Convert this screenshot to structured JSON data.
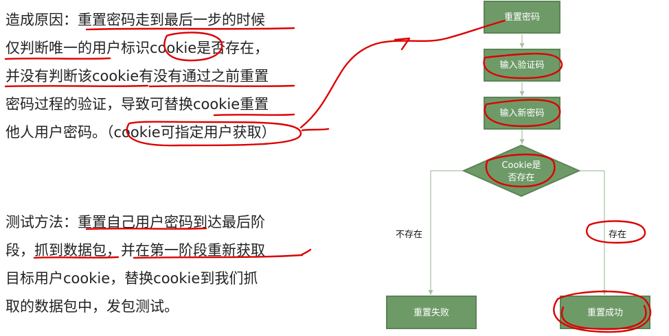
{
  "paragraph1": {
    "lines": [
      "造成原因：重置密码走到最后一步的时候",
      "仅判断唯一的用户标识cookie是否存在，",
      "并没有判断该cookie有没有通过之前重置",
      "密码过程的验证，导致可替换cookie重置",
      "他人用户密码。（cookie可指定用户获取）"
    ]
  },
  "paragraph2": {
    "lines": [
      "测试方法：重置自己用户密码到达最后阶",
      "段，抓到数据包，并在第一阶段重新获取",
      "目标用户cookie，替换cookie到我们抓",
      "取的数据包中，发包测试。"
    ]
  },
  "flowchart": {
    "step1": "重置密码",
    "step2": "输入验证码",
    "step3": "输入新密码",
    "decision_line1": "Cookie是",
    "decision_line2": "否存在",
    "branch_no": "不存在",
    "branch_yes": "存在",
    "result_fail": "重置失败",
    "result_success": "重置成功"
  },
  "colors": {
    "box_fill": "#6e9a68",
    "box_stroke": "#5a8455",
    "connector": "#a8bfa4",
    "annotation_red": "#dd0000",
    "text": "#222222"
  }
}
